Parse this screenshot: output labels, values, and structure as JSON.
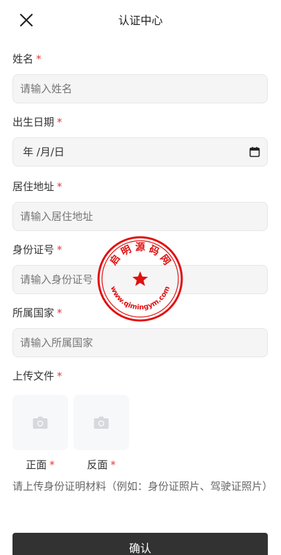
{
  "header": {
    "title": "认证中心",
    "close_icon": "close-icon"
  },
  "form": {
    "name": {
      "label": "姓名",
      "required": "*",
      "placeholder": "请输入姓名"
    },
    "birth": {
      "label": "出生日期",
      "required": "*",
      "value": "年 /月/日"
    },
    "address": {
      "label": "居住地址",
      "required": "*",
      "placeholder": "请输入居住地址"
    },
    "idnum": {
      "label": "身份证号",
      "required": "*",
      "placeholder": "请输入身份证号"
    },
    "country": {
      "label": "所属国家",
      "required": "*",
      "placeholder": "请输入所属国家"
    },
    "upload": {
      "label": "上传文件",
      "required": "*",
      "front": {
        "caption": "正面",
        "required": "*"
      },
      "back": {
        "caption": "反面",
        "required": "*"
      },
      "hint": "请上传身份证明材料（例如：身份证照片、驾驶证照片）"
    },
    "confirm_label": "确认"
  },
  "watermark": {
    "top_text": "启 明 源 码 网",
    "bottom_text": "www.qimingym.com",
    "color": "#e01010"
  },
  "colors": {
    "required": "#e53935",
    "button_bg": "#323232"
  }
}
